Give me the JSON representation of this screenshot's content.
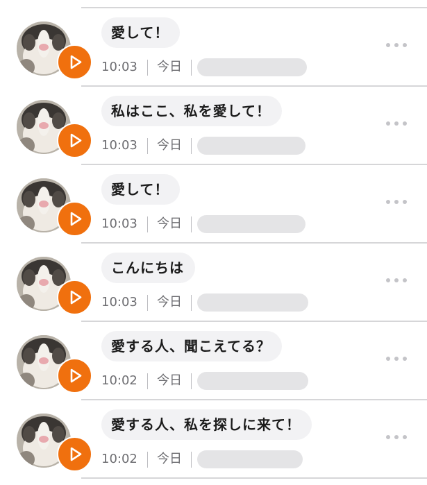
{
  "voice_messages": [
    {
      "text": "愛して！",
      "time": "10:03",
      "day": "今日",
      "more_icon": "more-dots-icon",
      "play_icon": "play-icon"
    },
    {
      "text": "私はここ、私を愛して！",
      "time": "10:03",
      "day": "今日",
      "more_icon": "more-dots-icon",
      "play_icon": "play-icon"
    },
    {
      "text": "愛して！",
      "time": "10:03",
      "day": "今日",
      "more_icon": "more-dots-icon",
      "play_icon": "play-icon"
    },
    {
      "text": "こんにちは",
      "time": "10:03",
      "day": "今日",
      "more_icon": "more-dots-icon",
      "play_icon": "play-icon"
    },
    {
      "text": "愛する人、聞こえてる？",
      "time": "10:02",
      "day": "今日",
      "more_icon": "more-dots-icon",
      "play_icon": "play-icon"
    },
    {
      "text": "愛する人、私を探しに来て！",
      "time": "10:02",
      "day": "今日",
      "more_icon": "more-dots-icon",
      "play_icon": "play-icon"
    }
  ],
  "colors": {
    "accent_orange": "#f0700e",
    "bubble_background": "#f2f2f4",
    "divider": "#d6d6d8",
    "redacted_name": "#e4e4e6"
  }
}
